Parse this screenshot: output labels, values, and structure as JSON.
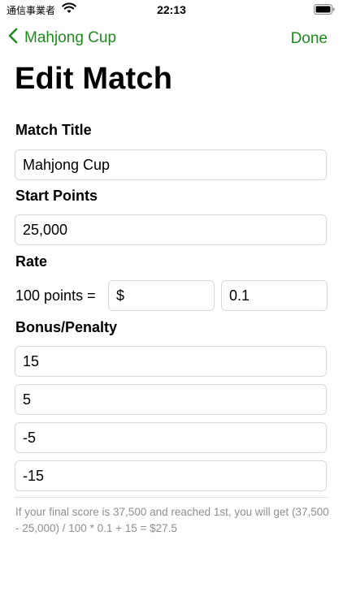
{
  "status_bar": {
    "carrier": "通信事業者",
    "time": "22:13",
    "wifi_icon": "wifi-icon",
    "battery_icon": "battery-icon"
  },
  "nav": {
    "back_label": "Mahjong Cup",
    "back_icon": "chevron-left-icon",
    "done_label": "Done",
    "accent_color": "#1f8a1f"
  },
  "page_title": "Edit Match",
  "match_title": {
    "label": "Match Title",
    "value": "Mahjong Cup"
  },
  "start_points": {
    "label": "Start Points",
    "value": "25,000"
  },
  "rate": {
    "label": "Rate",
    "prefix": "100 points =",
    "currency_value": "$",
    "amount_value": "0.1"
  },
  "bonus_penalty": {
    "label": "Bonus/Penalty",
    "values": [
      "15",
      "5",
      "-5",
      "-15"
    ]
  },
  "footer_note": "If your final score is 37,500 and reached 1st, you will get (37,500 - 25,000) / 100 * 0.1 + 15 = $27.5"
}
